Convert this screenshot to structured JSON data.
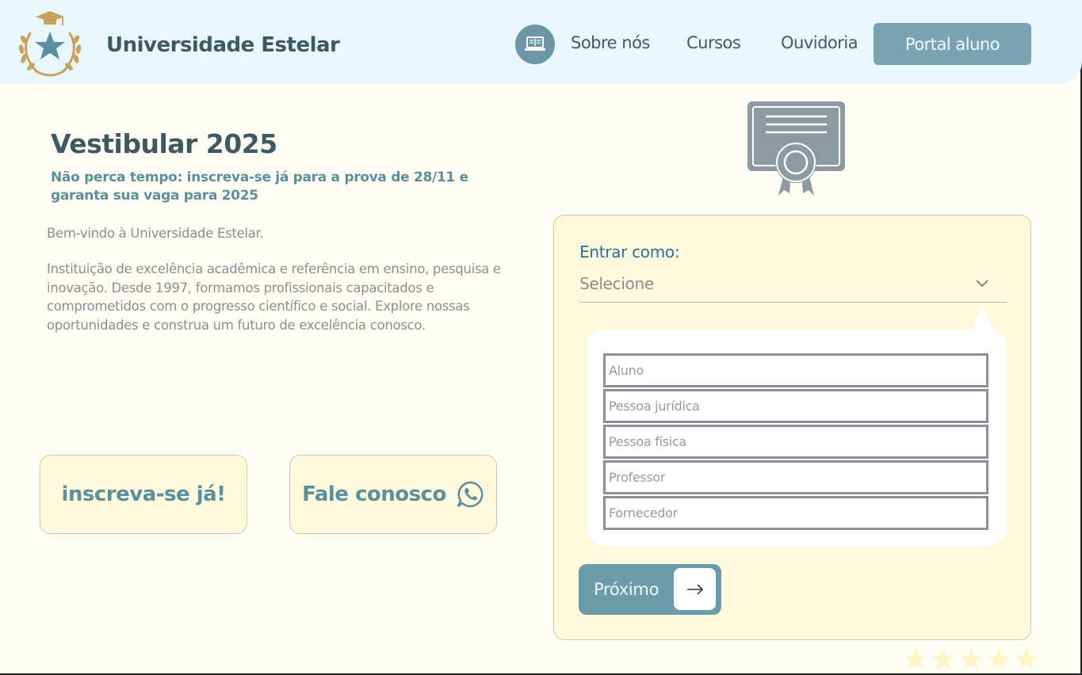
{
  "header": {
    "brand": "Universidade Estelar",
    "nav": [
      "Sobre nós",
      "Cursos",
      "Ouvidoria"
    ],
    "portal_button": "Portal aluno",
    "icons": {
      "logo": "laurel-star-logo",
      "nav": "laptop-icon"
    }
  },
  "hero": {
    "title": "Vestibular 2025",
    "subtitle": "Não perca tempo: inscreva-se já para a prova de 28/11 e garanta sua vaga para 2025",
    "welcome": "Bem-vindo à Universidade Estelar.",
    "description": "Instituição de excelência acadêmica e referência em ensino, pesquisa e inovação. Desde 1997, formamos profissionais capacitados e comprometidos com o progresso científico e social. Explore nossas oportunidades e construa um futuro de excelência conosco."
  },
  "cta": {
    "enroll": "inscreva-se já!",
    "contact": "Fale conosco",
    "contact_icon": "whatsapp-icon"
  },
  "login": {
    "label": "Entrar como:",
    "select_value": "Selecione",
    "options": [
      "Aluno",
      "Pessoa jurídica",
      "Pessoa física",
      "Professor",
      "Fornecedor"
    ],
    "next": "Próximo",
    "certificate_icon": "certificate-icon"
  },
  "rating": {
    "stars": 5,
    "max": 5
  },
  "colors": {
    "background": "#fffdf4",
    "header": "#e8f7fd",
    "accent": "#7aa3b1",
    "brand_text": "#3f5964",
    "panel": "#fef9dc",
    "star": "#fdf4c8"
  }
}
